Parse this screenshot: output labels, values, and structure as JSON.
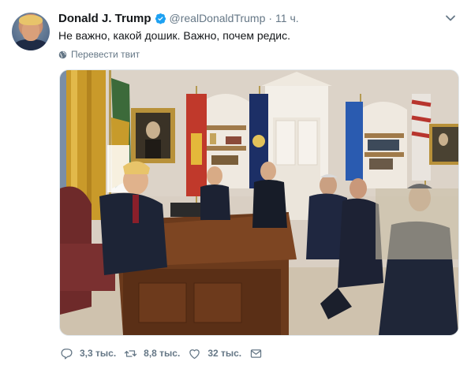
{
  "tweet": {
    "author_name": "Donald J. Trump",
    "handle": "@realDonaldTrump",
    "separator": "·",
    "time": "11 ч.",
    "text": "Не важно, какой дошик. Важно, почем редис.",
    "translate_label": "Перевести твит",
    "verified_color": "#1da1f2"
  },
  "actions": {
    "replies": "3,3 тыс.",
    "retweets": "8,8 тыс.",
    "likes": "32 тыс."
  },
  "icons": [
    "caret-down-icon",
    "verified-badge-icon",
    "globe-icon",
    "reply-icon",
    "retweet-icon",
    "like-icon",
    "message-icon"
  ],
  "colors": {
    "text_primary": "#14171a",
    "text_secondary": "#657786",
    "accent": "#1da1f2"
  }
}
